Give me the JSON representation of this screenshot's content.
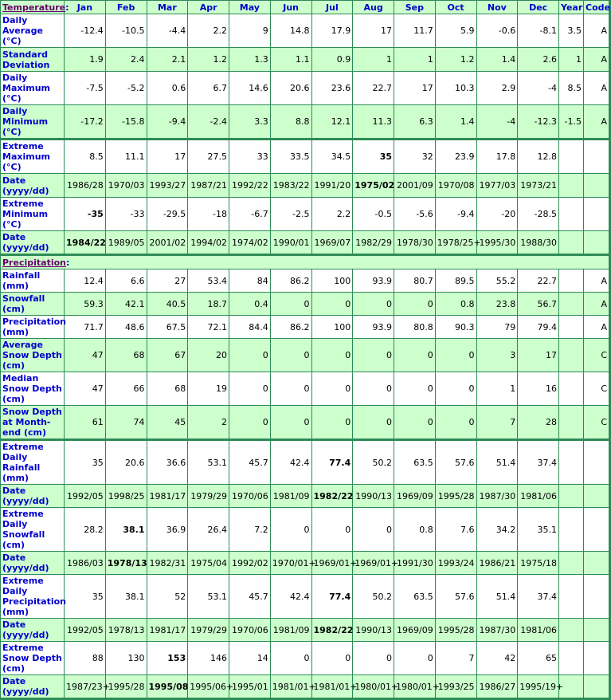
{
  "header": {
    "section_label": "Temperature",
    "colon": ":",
    "months": [
      "Jan",
      "Feb",
      "Mar",
      "Apr",
      "May",
      "Jun",
      "Jul",
      "Aug",
      "Sep",
      "Oct",
      "Nov",
      "Dec"
    ],
    "year": "Year",
    "code": "Code"
  },
  "temperature": {
    "rows": [
      {
        "label": "Daily Average (°C)",
        "values": [
          "-12.4",
          "-10.5",
          "-4.4",
          "2.2",
          "9",
          "14.8",
          "17.9",
          "17",
          "11.7",
          "5.9",
          "-0.6",
          "-8.1"
        ],
        "year": "3.5",
        "code": "A",
        "bold": []
      },
      {
        "label": "Standard Deviation",
        "values": [
          "1.9",
          "2.4",
          "2.1",
          "1.2",
          "1.3",
          "1.1",
          "0.9",
          "1",
          "1",
          "1.2",
          "1.4",
          "2.6"
        ],
        "year": "1",
        "code": "A",
        "bold": []
      },
      {
        "label": "Daily Maximum (°C)",
        "values": [
          "-7.5",
          "-5.2",
          "0.6",
          "6.7",
          "14.6",
          "20.6",
          "23.6",
          "22.7",
          "17",
          "10.3",
          "2.9",
          "-4"
        ],
        "year": "8.5",
        "code": "A",
        "bold": []
      },
      {
        "label": "Daily Minimum (°C)",
        "values": [
          "-17.2",
          "-15.8",
          "-9.4",
          "-2.4",
          "3.3",
          "8.8",
          "12.1",
          "11.3",
          "6.3",
          "1.4",
          "-4",
          "-12.3"
        ],
        "year": "-1.5",
        "code": "A",
        "bold": []
      },
      {
        "label": "Extreme Maximum (°C)",
        "values": [
          "8.5",
          "11.1",
          "17",
          "27.5",
          "33",
          "33.5",
          "34.5",
          "35",
          "32",
          "23.9",
          "17.8",
          "12.8"
        ],
        "year": "",
        "code": "",
        "bold": [
          7
        ]
      },
      {
        "label": "Date (yyyy/dd)",
        "values": [
          "1986/28",
          "1970/03",
          "1993/27",
          "1987/21",
          "1992/22",
          "1983/22",
          "1991/20",
          "1975/02",
          "2001/09",
          "1970/08",
          "1977/03",
          "1973/21"
        ],
        "year": "",
        "code": "",
        "bold": [
          7
        ]
      },
      {
        "label": "Extreme Minimum (°C)",
        "values": [
          "-35",
          "-33",
          "-29.5",
          "-18",
          "-6.7",
          "-2.5",
          "2.2",
          "-0.5",
          "-5.6",
          "-9.4",
          "-20",
          "-28.5"
        ],
        "year": "",
        "code": "",
        "bold": [
          0
        ]
      },
      {
        "label": "Date (yyyy/dd)",
        "values": [
          "1984/22",
          "1989/05",
          "2001/02",
          "1994/02",
          "1974/02",
          "1990/01",
          "1969/07",
          "1982/29",
          "1978/30",
          "1978/25+",
          "1995/30",
          "1988/30"
        ],
        "year": "",
        "code": "",
        "bold": [
          0
        ]
      }
    ]
  },
  "precipitation": {
    "section_label": "Precipitation",
    "colon": ":",
    "rows": [
      {
        "label": "Rainfall (mm)",
        "values": [
          "12.4",
          "6.6",
          "27",
          "53.4",
          "84",
          "86.2",
          "100",
          "93.9",
          "80.7",
          "89.5",
          "55.2",
          "22.7"
        ],
        "year": "",
        "code": "A",
        "bold": []
      },
      {
        "label": "Snowfall (cm)",
        "values": [
          "59.3",
          "42.1",
          "40.5",
          "18.7",
          "0.4",
          "0",
          "0",
          "0",
          "0",
          "0.8",
          "23.8",
          "56.7"
        ],
        "year": "",
        "code": "A",
        "bold": []
      },
      {
        "label": "Precipitation (mm)",
        "values": [
          "71.7",
          "48.6",
          "67.5",
          "72.1",
          "84.4",
          "86.2",
          "100",
          "93.9",
          "80.8",
          "90.3",
          "79",
          "79.4"
        ],
        "year": "",
        "code": "A",
        "bold": []
      },
      {
        "label": "Average Snow Depth (cm)",
        "values": [
          "47",
          "68",
          "67",
          "20",
          "0",
          "0",
          "0",
          "0",
          "0",
          "0",
          "3",
          "17"
        ],
        "year": "",
        "code": "C",
        "bold": []
      },
      {
        "label": "Median Snow Depth (cm)",
        "values": [
          "47",
          "66",
          "68",
          "19",
          "0",
          "0",
          "0",
          "0",
          "0",
          "0",
          "1",
          "16"
        ],
        "year": "",
        "code": "C",
        "bold": []
      },
      {
        "label": "Snow Depth at Month-end (cm)",
        "values": [
          "61",
          "74",
          "45",
          "2",
          "0",
          "0",
          "0",
          "0",
          "0",
          "0",
          "7",
          "28"
        ],
        "year": "",
        "code": "C",
        "bold": []
      },
      {
        "label": "Extreme Daily Rainfall (mm)",
        "values": [
          "35",
          "20.6",
          "36.6",
          "53.1",
          "45.7",
          "42.4",
          "77.4",
          "50.2",
          "63.5",
          "57.6",
          "51.4",
          "37.4"
        ],
        "year": "",
        "code": "",
        "bold": [
          6
        ]
      },
      {
        "label": "Date (yyyy/dd)",
        "values": [
          "1992/05",
          "1998/25",
          "1981/17",
          "1979/29",
          "1970/06",
          "1981/09",
          "1982/22",
          "1990/13",
          "1969/09",
          "1995/28",
          "1987/30",
          "1981/06"
        ],
        "year": "",
        "code": "",
        "bold": [
          6
        ]
      },
      {
        "label": "Extreme Daily Snowfall (cm)",
        "values": [
          "28.2",
          "38.1",
          "36.9",
          "26.4",
          "7.2",
          "0",
          "0",
          "0",
          "0.8",
          "7.6",
          "34.2",
          "35.1"
        ],
        "year": "",
        "code": "",
        "bold": [
          1
        ]
      },
      {
        "label": "Date (yyyy/dd)",
        "values": [
          "1986/03",
          "1978/13",
          "1982/31",
          "1975/04",
          "1992/02",
          "1970/01+",
          "1969/01+",
          "1969/01+",
          "1991/30",
          "1993/24",
          "1986/21",
          "1975/18"
        ],
        "year": "",
        "code": "",
        "bold": [
          1
        ]
      },
      {
        "label": "Extreme Daily Precipitation (mm)",
        "values": [
          "35",
          "38.1",
          "52",
          "53.1",
          "45.7",
          "42.4",
          "77.4",
          "50.2",
          "63.5",
          "57.6",
          "51.4",
          "37.4"
        ],
        "year": "",
        "code": "",
        "bold": [
          6
        ]
      },
      {
        "label": "Date (yyyy/dd)",
        "values": [
          "1992/05",
          "1978/13",
          "1981/17",
          "1979/29",
          "1970/06",
          "1981/09",
          "1982/22",
          "1990/13",
          "1969/09",
          "1995/28",
          "1987/30",
          "1981/06"
        ],
        "year": "",
        "code": "",
        "bold": [
          6
        ]
      },
      {
        "label": "Extreme Snow Depth (cm)",
        "values": [
          "88",
          "130",
          "153",
          "146",
          "14",
          "0",
          "0",
          "0",
          "0",
          "7",
          "42",
          "65"
        ],
        "year": "",
        "code": "",
        "bold": [
          2
        ]
      },
      {
        "label": "Date (yyyy/dd)",
        "values": [
          "1987/23+",
          "1995/28",
          "1995/08",
          "1995/06+",
          "1995/01",
          "1981/01+",
          "1981/01+",
          "1980/01+",
          "1980/01+",
          "1993/25",
          "1986/27",
          "1995/19+"
        ],
        "year": "",
        "code": "",
        "bold": [
          2
        ]
      }
    ]
  },
  "colors": {
    "border": "#2e8b57",
    "row_green": "#ccffcc",
    "row_white": "#ffffff",
    "label_blue": "#0000cc",
    "section_purple": "#660066"
  }
}
